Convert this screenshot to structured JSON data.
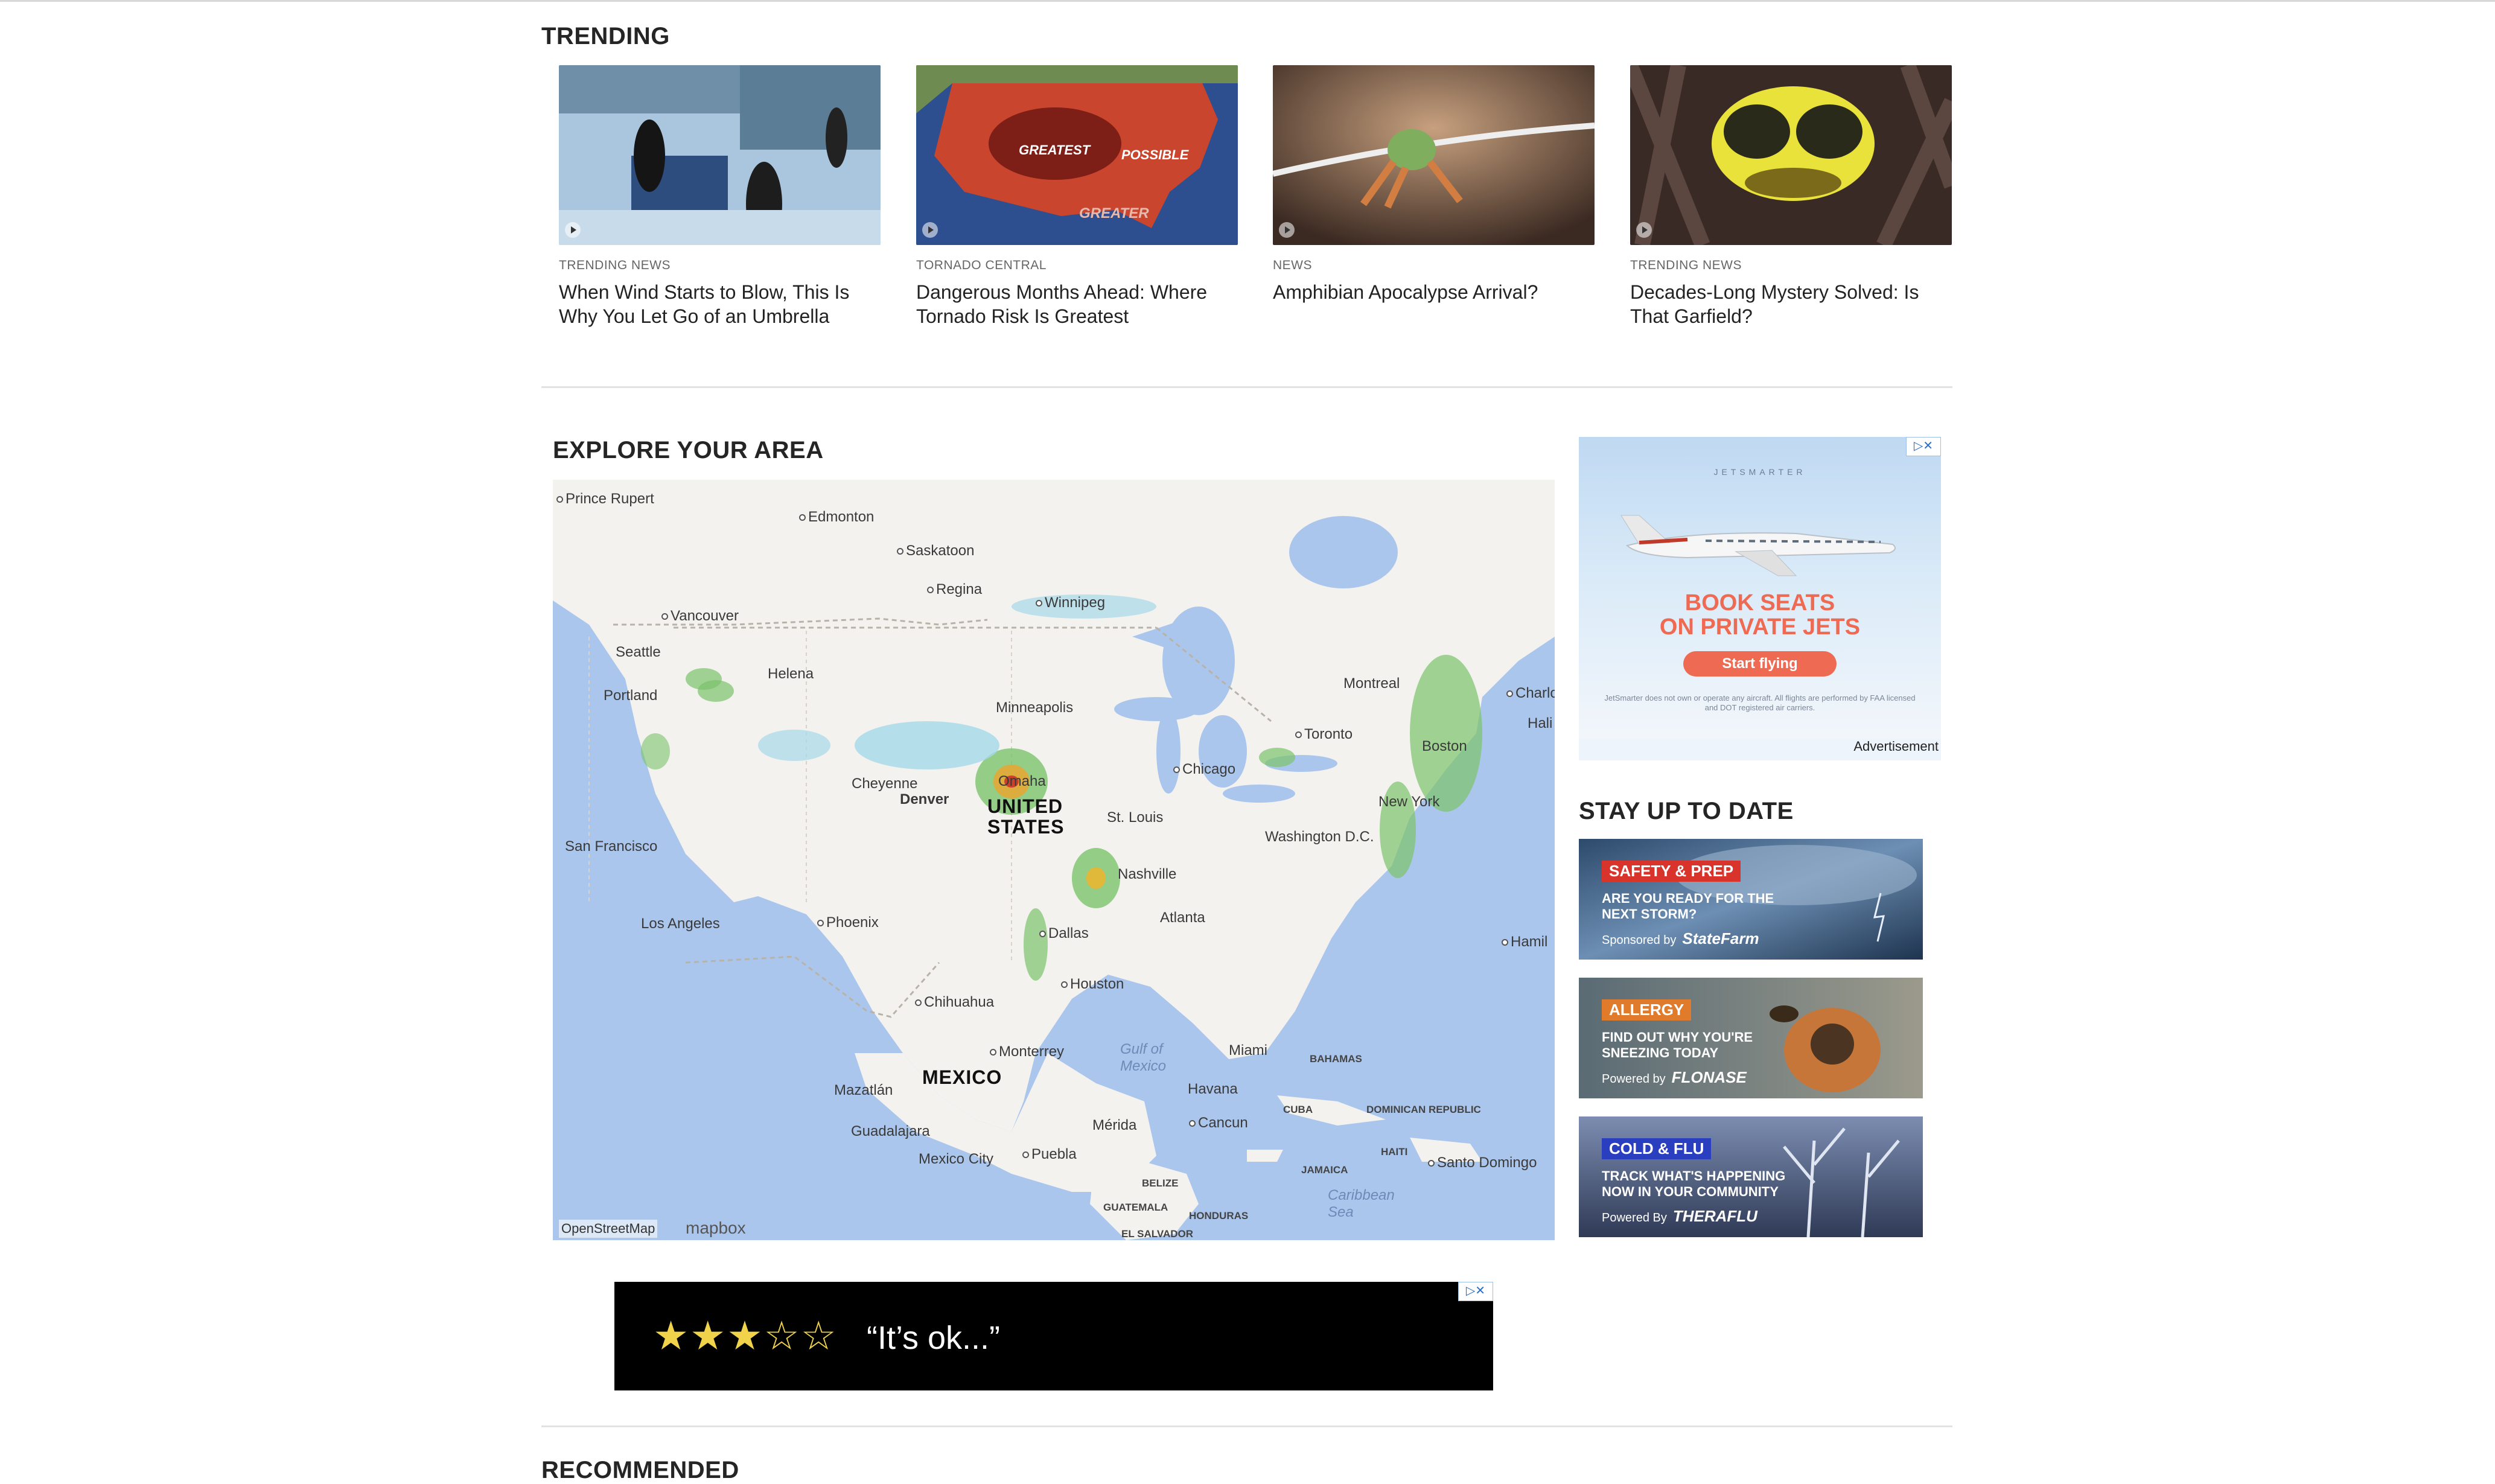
{
  "trending": {
    "title": "TRENDING",
    "cards": [
      {
        "category": "TRENDING NEWS",
        "headline": "When Wind Starts to Blow, This Is Why You Let Go of an Umbrella"
      },
      {
        "category": "TORNADO CENTRAL",
        "headline": "Dangerous Months Ahead: Where Tornado Risk Is Greatest",
        "overlay": [
          "GREATEST",
          "POSSIBLE",
          "GREATER"
        ]
      },
      {
        "category": "NEWS",
        "headline": "Amphibian Apocalypse Arrival?"
      },
      {
        "category": "TRENDING NEWS",
        "headline": "Decades-Long Mystery Solved: Is That Garfield?"
      }
    ]
  },
  "explore": {
    "title": "EXPLORE YOUR AREA",
    "map": {
      "cities": [
        "Prince Rupert",
        "Edmonton",
        "Saskatoon",
        "Regina",
        "Winnipeg",
        "Vancouver",
        "Seattle",
        "Portland",
        "Helena",
        "Minneapolis",
        "Montreal",
        "Toronto",
        "Charlottetown",
        "Hali",
        "Cheyenne",
        "Denver",
        "Omaha",
        "Chicago",
        "Boston",
        "New York",
        "St. Louis",
        "Washington D.C.",
        "San Francisco",
        "Nashville",
        "Los Angeles",
        "Phoenix",
        "Atlanta",
        "Dallas",
        "Hamil",
        "Houston",
        "Chihuahua",
        "Monterrey",
        "Miami",
        "Mazatlán",
        "Havana",
        "Guadalajara",
        "Mérida",
        "Cancun",
        "Mexico City",
        "Puebla",
        "Santo Domingo"
      ],
      "countries": [
        "UNITED STATES",
        "MEXICO"
      ],
      "small_labels": [
        "BAHAMAS",
        "CUBA",
        "DOMINICAN REPUBLIC",
        "HAITI",
        "JAMAICA",
        "BELIZE",
        "GUATEMALA",
        "HONDURAS",
        "EL SALVADOR"
      ],
      "seas": [
        "Gulf of Mexico",
        "Caribbean Sea"
      ],
      "attribution": "OpenStreetMap",
      "provider": "mapbox"
    }
  },
  "ad_right": {
    "brand": "JETSMARTER",
    "headline_1": "BOOK SEATS",
    "headline_2": "ON PRIVATE JETS",
    "cta": "Start flying",
    "fine_print": "JetSmarter does not own or operate any aircraft. All flights are performed by FAA licensed and DOT registered air carriers.",
    "label": "Advertisement",
    "adchoices": "▷✕"
  },
  "stay": {
    "title": "STAY UP TO DATE",
    "promos": [
      {
        "tag": "SAFETY & PREP",
        "desc": "ARE YOU READY FOR THE NEXT STORM?",
        "sponsor_prefix": "Sponsored by",
        "sponsor": "StateFarm",
        "tag_color": "#d9342b"
      },
      {
        "tag": "ALLERGY",
        "desc": "FIND OUT WHY YOU'RE SNEEZING TODAY",
        "sponsor_prefix": "Powered by",
        "sponsor": "FLONASE",
        "tag_color": "#e07b2c"
      },
      {
        "tag": "COLD & FLU",
        "desc": "TRACK WHAT'S HAPPENING NOW IN YOUR COMMUNITY",
        "sponsor_prefix": "Powered By",
        "sponsor": "THERAFLU",
        "tag_color": "#2a3fbf"
      }
    ]
  },
  "ad_bottom": {
    "stars": "★★★☆☆",
    "rating": 3,
    "quote": "“It’s ok...”",
    "adchoices": "▷✕"
  },
  "recommended": {
    "title": "RECOMMENDED"
  }
}
